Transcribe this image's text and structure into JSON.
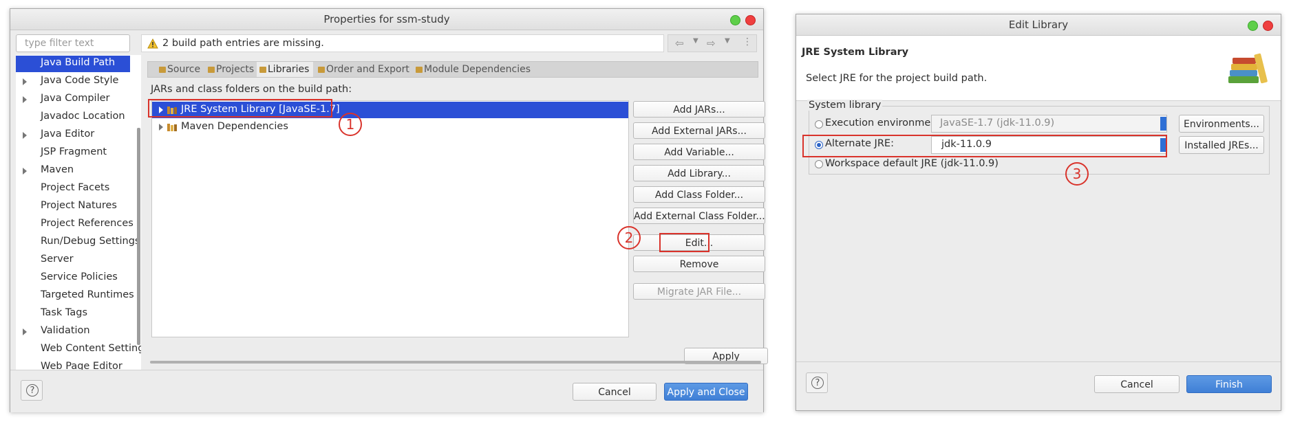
{
  "properties_dialog": {
    "title": "Properties for ssm-study",
    "filter_placeholder": "type filter text",
    "warning_text": "2 build path entries are missing.",
    "nav_items": [
      {
        "label": "Java Build Path",
        "expandable": false,
        "selected": true
      },
      {
        "label": "Java Code Style",
        "expandable": true
      },
      {
        "label": "Java Compiler",
        "expandable": true
      },
      {
        "label": "Javadoc Location",
        "expandable": false
      },
      {
        "label": "Java Editor",
        "expandable": true
      },
      {
        "label": "JSP Fragment",
        "expandable": false
      },
      {
        "label": "Maven",
        "expandable": true
      },
      {
        "label": "Project Facets",
        "expandable": false
      },
      {
        "label": "Project Natures",
        "expandable": false
      },
      {
        "label": "Project References",
        "expandable": false
      },
      {
        "label": "Run/Debug Settings",
        "expandable": false
      },
      {
        "label": "Server",
        "expandable": false
      },
      {
        "label": "Service Policies",
        "expandable": false
      },
      {
        "label": "Targeted Runtimes",
        "expandable": false
      },
      {
        "label": "Task Tags",
        "expandable": false
      },
      {
        "label": "Validation",
        "expandable": true
      },
      {
        "label": "Web Content Settings",
        "expandable": false
      },
      {
        "label": "Web Page Editor",
        "expandable": false
      }
    ],
    "tabs": [
      "Source",
      "Projects",
      "Libraries",
      "Order and Export",
      "Module Dependencies"
    ],
    "active_tab": "Libraries",
    "section_label": "JARs and class folders on the build path:",
    "tree_items": [
      {
        "label": "JRE System Library [JavaSE-1.7]",
        "selected": true
      },
      {
        "label": "Maven Dependencies",
        "selected": false
      }
    ],
    "side_buttons": {
      "add_jars": "Add JARs...",
      "add_external_jars": "Add External JARs...",
      "add_variable": "Add Variable...",
      "add_library": "Add Library...",
      "add_class_folder": "Add Class Folder...",
      "add_external_class_folder": "Add External Class Folder...",
      "edit": "Edit...",
      "remove": "Remove",
      "migrate_jar": "Migrate JAR File..."
    },
    "apply": "Apply",
    "cancel": "Cancel",
    "apply_and_close": "Apply and Close",
    "help": "?"
  },
  "edit_library_dialog": {
    "title": "Edit Library",
    "heading": "JRE System Library",
    "description": "Select JRE for the project build path.",
    "group_label": "System library",
    "execution_env_label": "Execution environment:",
    "execution_env_value": "JavaSE-1.7 (jdk-11.0.9)",
    "environments_button": "Environments...",
    "alternate_jre_label": "Alternate JRE:",
    "alternate_jre_value": "jdk-11.0.9",
    "installed_jres_button": "Installed JREs...",
    "workspace_default_label": "Workspace default JRE (jdk-11.0.9)",
    "selected_option": "Alternate JRE",
    "cancel": "Cancel",
    "finish": "Finish",
    "help": "?"
  },
  "annotations": {
    "step1": "1",
    "step2": "2",
    "step3": "3",
    "color": "#d9332b"
  }
}
